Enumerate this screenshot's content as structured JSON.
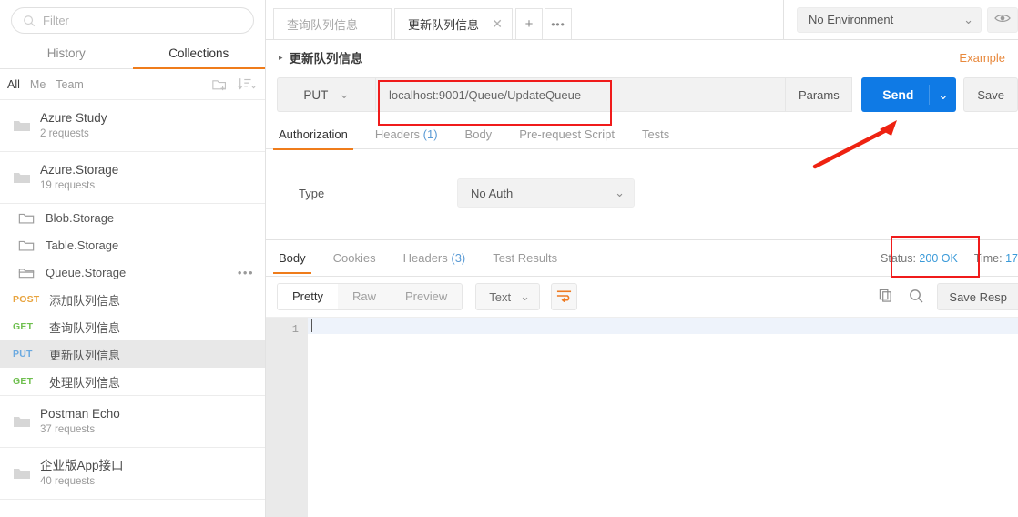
{
  "sidebar": {
    "search": {
      "placeholder": "Filter",
      "icon": "search-icon"
    },
    "tabs": [
      {
        "label": "History",
        "active": false
      },
      {
        "label": "Collections",
        "active": true
      }
    ],
    "scopes": [
      {
        "label": "All",
        "active": true
      },
      {
        "label": "Me",
        "active": false
      },
      {
        "label": "Team",
        "active": false
      }
    ],
    "scope_icons": [
      "new-folder-icon",
      "sort-icon"
    ],
    "collections": [
      {
        "name": "Azure Study",
        "requests": "2 requests"
      },
      {
        "name": "Azure.Storage",
        "requests": "19 requests"
      }
    ],
    "folders": [
      {
        "name": "Blob.Storage",
        "open": false
      },
      {
        "name": "Table.Storage",
        "open": false
      },
      {
        "name": "Queue.Storage",
        "open": true,
        "menu": "•••"
      }
    ],
    "requests": [
      {
        "method": "POST",
        "name": "添加队列信息",
        "selected": false
      },
      {
        "method": "GET",
        "name": "查询队列信息",
        "selected": false
      },
      {
        "method": "PUT",
        "name": "更新队列信息",
        "selected": true
      },
      {
        "method": "GET",
        "name": "处理队列信息",
        "selected": false
      }
    ],
    "collections_bottom": [
      {
        "name": "Postman Echo",
        "requests": "37 requests"
      },
      {
        "name": "企业版App接口",
        "requests": "40 requests"
      }
    ]
  },
  "topbar": {
    "tabs": [
      {
        "label": "查询队列信息",
        "active": false,
        "close": ""
      },
      {
        "label": "更新队列信息",
        "active": true,
        "close": "✕"
      }
    ],
    "new_tab": "+",
    "more": "•••",
    "environment": {
      "value": "No Environment",
      "chevron": "⌄"
    },
    "eye_icon": "eye-icon"
  },
  "request": {
    "title": "更新队列信息",
    "caret": "▸",
    "example_link": "Example",
    "method": "PUT",
    "method_chevron": "⌄",
    "url": "localhost:9001/Queue/UpdateQueue",
    "params_label": "Params",
    "send_label": "Send",
    "send_chevron": "⌄",
    "save_label": "Save",
    "tabs": [
      {
        "label": "Authorization",
        "count": "",
        "active": true
      },
      {
        "label": "Headers",
        "count": "(1)",
        "active": false
      },
      {
        "label": "Body",
        "count": "",
        "active": false
      },
      {
        "label": "Pre-request Script",
        "count": "",
        "active": false
      },
      {
        "label": "Tests",
        "count": "",
        "active": false
      }
    ],
    "auth": {
      "type_label": "Type",
      "type_value": "No Auth",
      "chevron": "⌄"
    }
  },
  "response": {
    "tabs": [
      {
        "label": "Body",
        "count": "",
        "active": true
      },
      {
        "label": "Cookies",
        "count": "",
        "active": false
      },
      {
        "label": "Headers",
        "count": "(3)",
        "active": false
      },
      {
        "label": "Test Results",
        "count": "",
        "active": false
      }
    ],
    "status_label": "Status:",
    "status_value": "200 OK",
    "time_label": "Time:",
    "time_value": "17",
    "formats": [
      {
        "label": "Pretty",
        "active": true
      },
      {
        "label": "Raw",
        "active": false
      },
      {
        "label": "Preview",
        "active": false
      }
    ],
    "type_value": "Text",
    "type_chevron": "⌄",
    "wrap_icon": "word-wrap-icon",
    "copy_icon": "copy-icon",
    "search_icon": "search-icon",
    "save_response_label": "Save Resp",
    "line_number": "1",
    "body_text": ""
  },
  "annotations": {
    "url_box_color": "#f01b1b",
    "status_box_color": "#f01b1b",
    "arrow_color": "#ee2211"
  }
}
